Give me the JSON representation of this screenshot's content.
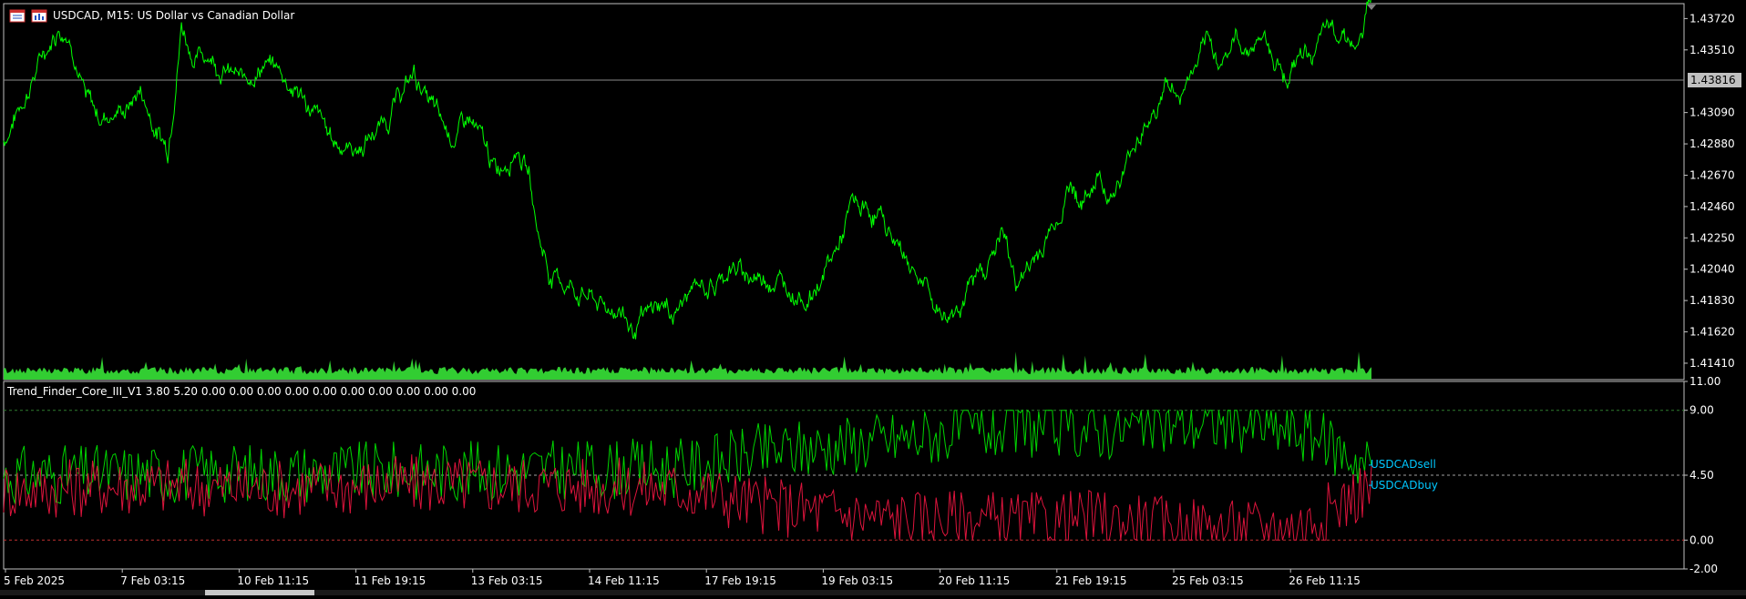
{
  "header": {
    "symbol_line": "USDCAD, M15:  US Dollar vs Canadian Dollar"
  },
  "current_price": "1.43816",
  "indicator": {
    "label": "Trend_Finder_Core_III_V1 3.80 5.20 0.00 0.00 0.00 0.00 0.00 0.00 0.00 0.00 0.00 0.00",
    "sell_label": "USDCADsell",
    "buy_label": "USDCADbuy"
  },
  "colors": {
    "background": "#000000",
    "price_line": "#00ff00",
    "volume": "#32cd32",
    "sell_line": "#00d400",
    "buy_line": "#dc143c",
    "axis_text": "#ffffff",
    "label_accent": "#00c8ff"
  },
  "chart_data": [
    {
      "type": "line",
      "title": "USDCAD, M15:  US Dollar vs Canadian Dollar",
      "y_ticks": [
        "1.43720",
        "1.43510",
        "1.43090",
        "1.42880",
        "1.42670",
        "1.42460",
        "1.42250",
        "1.42040",
        "1.41830",
        "1.41620",
        "1.41410"
      ],
      "ylim": [
        1.413,
        1.4382
      ],
      "current_value": 1.43816,
      "x_ticks": [
        "5 Feb 2025",
        "7 Feb 03:15",
        "10 Feb 11:15",
        "11 Feb 19:15",
        "13 Feb 03:15",
        "14 Feb 11:15",
        "17 Feb 19:15",
        "19 Feb 03:15",
        "20 Feb 11:15",
        "21 Feb 19:15",
        "25 Feb 03:15",
        "26 Feb 11:15"
      ],
      "series": [
        {
          "name": "USDCAD",
          "x": [
            0,
            0.01,
            0.02,
            0.03,
            0.04,
            0.05,
            0.06,
            0.07,
            0.075,
            0.09,
            0.1,
            0.11,
            0.12,
            0.13,
            0.14,
            0.15,
            0.16,
            0.175,
            0.18,
            0.19,
            0.2,
            0.22,
            0.24,
            0.26,
            0.28,
            0.3,
            0.32,
            0.33,
            0.34,
            0.355,
            0.36,
            0.375,
            0.385,
            0.39,
            0.4,
            0.42,
            0.43,
            0.44,
            0.45,
            0.46,
            0.47,
            0.48,
            0.49,
            0.5,
            0.51,
            0.52,
            0.53,
            0.55,
            0.56,
            0.57,
            0.59,
            0.61,
            0.62,
            0.64,
            0.65,
            0.67,
            0.68,
            0.69,
            0.7,
            0.71,
            0.72,
            0.73,
            0.74,
            0.75,
            0.76,
            0.77,
            0.78,
            0.79,
            0.8,
            0.81,
            0.82,
            0.83,
            0.84,
            0.85,
            0.86,
            0.87,
            0.88,
            0.89,
            0.9,
            0.91,
            0.92,
            0.93,
            0.94,
            0.95,
            0.96,
            0.97,
            0.98,
            0.99,
            1.0
          ],
          "values": [
            1.429,
            1.431,
            1.433,
            1.435,
            1.4368,
            1.436,
            1.4318,
            1.4305,
            1.4308,
            1.4312,
            1.4325,
            1.43,
            1.4285,
            1.437,
            1.4345,
            1.435,
            1.434,
            1.4328,
            1.4335,
            1.4342,
            1.4338,
            1.4318,
            1.429,
            1.4285,
            1.4305,
            1.4335,
            1.43,
            1.4292,
            1.4305,
            1.4278,
            1.4268,
            1.429,
            1.4265,
            1.423,
            1.42,
            1.419,
            1.4185,
            1.4176,
            1.418,
            1.4162,
            1.417,
            1.418,
            1.4175,
            1.4185,
            1.4195,
            1.4192,
            1.4205,
            1.4198,
            1.42,
            1.4195,
            1.4185,
            1.4218,
            1.4245,
            1.424,
            1.4225,
            1.42,
            1.418,
            1.4172,
            1.4185,
            1.4195,
            1.421,
            1.423,
            1.4195,
            1.4205,
            1.422,
            1.424,
            1.4262,
            1.4248,
            1.4268,
            1.4255,
            1.427,
            1.4298,
            1.4305,
            1.4328,
            1.432,
            1.4338,
            1.435,
            1.4345,
            1.4358,
            1.4352,
            1.4362,
            1.4345,
            1.4335,
            1.4348,
            1.4352,
            1.4362,
            1.4368,
            1.435,
            1.4382
          ]
        }
      ]
    },
    {
      "type": "line",
      "title": "Trend_Finder_Core_III_V1 3.80 5.20 0.00 0.00 0.00 0.00 0.00 0.00 0.00 0.00 0.00 0.00",
      "y_ticks": [
        "11.00",
        "9.00",
        "4.50",
        "0.00",
        "-2.00"
      ],
      "ylim": [
        -2,
        11
      ],
      "levels": [
        9.0,
        4.5,
        0.0
      ],
      "series": [
        {
          "name": "USDCADsell",
          "x": [
            0,
            0.1,
            0.2,
            0.3,
            0.4,
            0.5,
            0.55,
            0.6,
            0.65,
            0.7,
            0.75,
            0.8,
            0.85,
            0.9,
            0.95,
            1.0
          ],
          "values": [
            4.5,
            4.6,
            4.7,
            4.8,
            4.9,
            5.0,
            6.0,
            6.5,
            7.0,
            7.5,
            7.8,
            7.6,
            8.0,
            8.2,
            7.5,
            5.2
          ]
        },
        {
          "name": "USDCADbuy",
          "x": [
            0,
            0.1,
            0.2,
            0.3,
            0.4,
            0.5,
            0.55,
            0.6,
            0.65,
            0.7,
            0.75,
            0.8,
            0.85,
            0.9,
            0.95,
            1.0
          ],
          "values": [
            3.5,
            3.8,
            3.6,
            3.9,
            3.8,
            3.5,
            2.5,
            2.0,
            1.5,
            1.5,
            1.2,
            1.5,
            1.0,
            0.8,
            1.0,
            3.8
          ]
        }
      ]
    }
  ]
}
